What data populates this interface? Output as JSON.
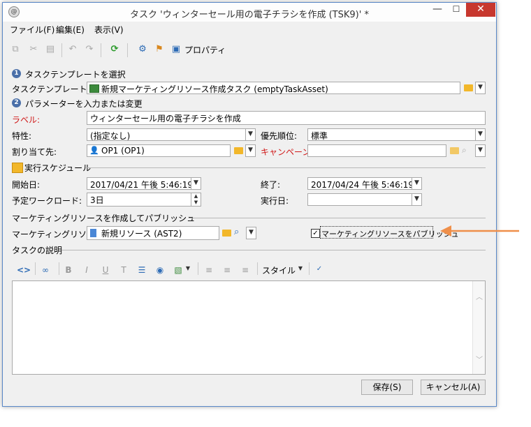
{
  "window": {
    "title": "タスク 'ウィンターセール用の電子チラシを作成 (TSK9)' *",
    "minimize": "—",
    "maximize": "☐",
    "close": "✕"
  },
  "menu": [
    "ファイル(F)",
    "編集(E)",
    "表示(V)"
  ],
  "toolbar": {
    "properties_label": "プロパティ"
  },
  "section1": {
    "number": "1",
    "title": "タスクテンプレートを選択"
  },
  "task_template": {
    "label": "タスクテンプレート:",
    "value": "新規マーケティングリソース作成タスク (emptyTaskAsset)"
  },
  "section2": {
    "number": "2",
    "title": "パラメーターを入力または変更"
  },
  "label_field": {
    "label": "ラベル:",
    "value": "ウィンターセール用の電子チラシを作成"
  },
  "nature": {
    "label": "特性:",
    "value": "(指定なし)"
  },
  "priority": {
    "label": "優先順位:",
    "value": "標準"
  },
  "assigned": {
    "label": "割り当て先:",
    "value": "OP1 (OP1)"
  },
  "campaign": {
    "label": "キャンペーン:",
    "value": ""
  },
  "schedule": {
    "title": "実行スケジュール"
  },
  "start": {
    "label": "開始日:",
    "value": "2017/04/21 午後 5:46:19"
  },
  "end": {
    "label": "終了:",
    "value": "2017/04/24 午後 5:46:19"
  },
  "workload": {
    "label": "予定ワークロード:",
    "value": "3日"
  },
  "exec_date": {
    "label": "実行日:",
    "value": ""
  },
  "publish_section": {
    "title": "マーケティングリソースを作成してパブリッシュ"
  },
  "resource": {
    "label": "マーケティングリソース:",
    "value": "新規リソース (AST2)"
  },
  "publish_checkbox": {
    "label": "マーケティングリソースをパブリッシュ",
    "checked": true
  },
  "description": {
    "title": "タスクの説明"
  },
  "editor_toolbar": {
    "style_label": "スタイル"
  },
  "buttons": {
    "save": "保存(S)",
    "cancel": "キャンセル(A)"
  },
  "colors": {
    "accent_arrow": "#ef8f4a",
    "required_label": "#d01919",
    "close_button": "#c7372e"
  }
}
